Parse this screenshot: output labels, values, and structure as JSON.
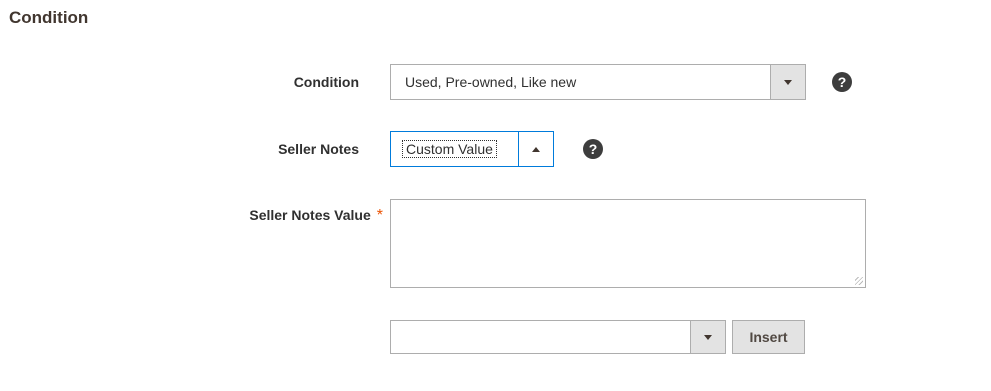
{
  "section": {
    "title": "Condition"
  },
  "condition": {
    "label": "Condition",
    "value": "Used, Pre-owned, Like new",
    "help": "?"
  },
  "seller_notes": {
    "label": "Seller Notes",
    "value": "Custom Value",
    "help": "?"
  },
  "seller_notes_value": {
    "label": "Seller Notes Value",
    "required_mark": "*",
    "value": ""
  },
  "insert_row": {
    "select_value": "",
    "insert_label": "Insert"
  },
  "colors": {
    "required": "#eb5202",
    "focus_border": "#007bdb",
    "help_bg": "#3d3d3d"
  }
}
